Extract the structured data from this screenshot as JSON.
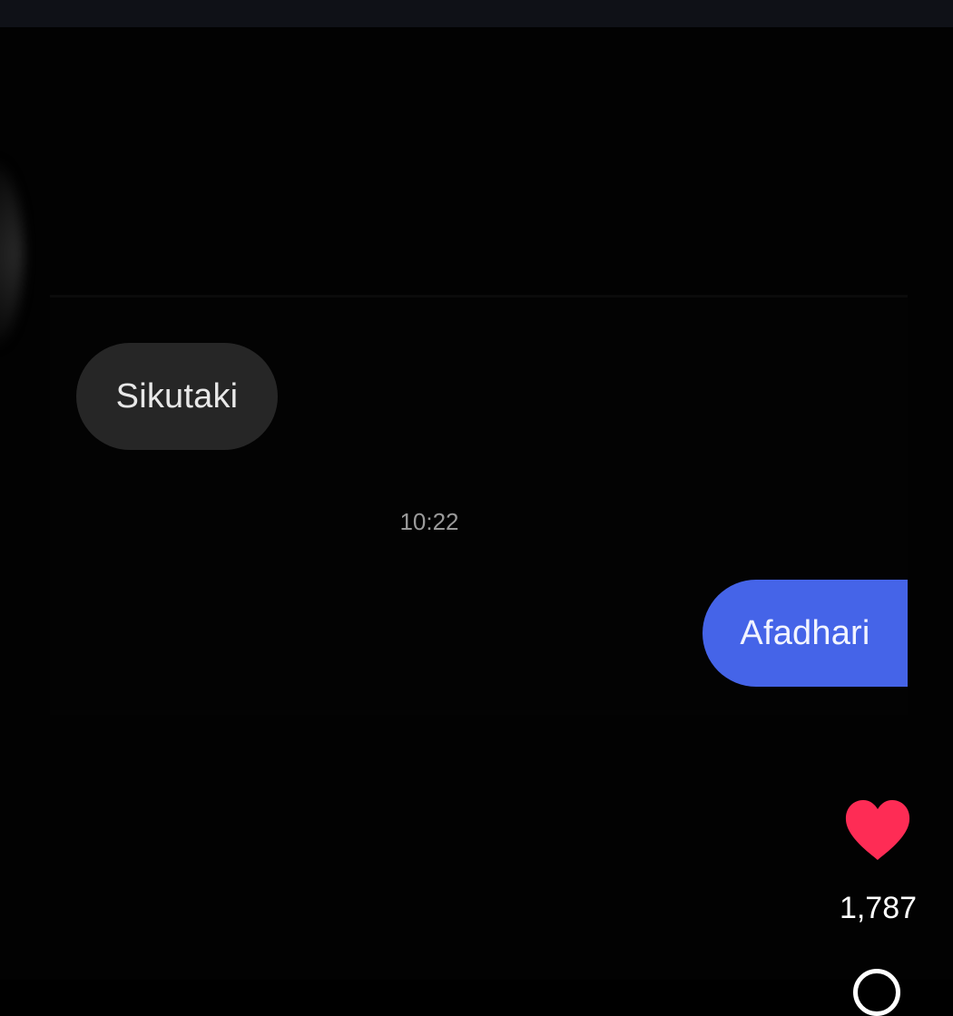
{
  "messages": [
    {
      "direction": "received",
      "text": "Sikutaki"
    },
    {
      "direction": "sent",
      "text": "Afadhari"
    }
  ],
  "timestamp": "10:22",
  "actions": {
    "like": {
      "icon": "heart-icon",
      "count": "1,787",
      "color": "#fe2c55"
    },
    "comment": {
      "icon": "comment-icon"
    }
  },
  "colors": {
    "sent_bubble": "#4564e8",
    "received_bubble": "#262626",
    "background": "#000000"
  }
}
